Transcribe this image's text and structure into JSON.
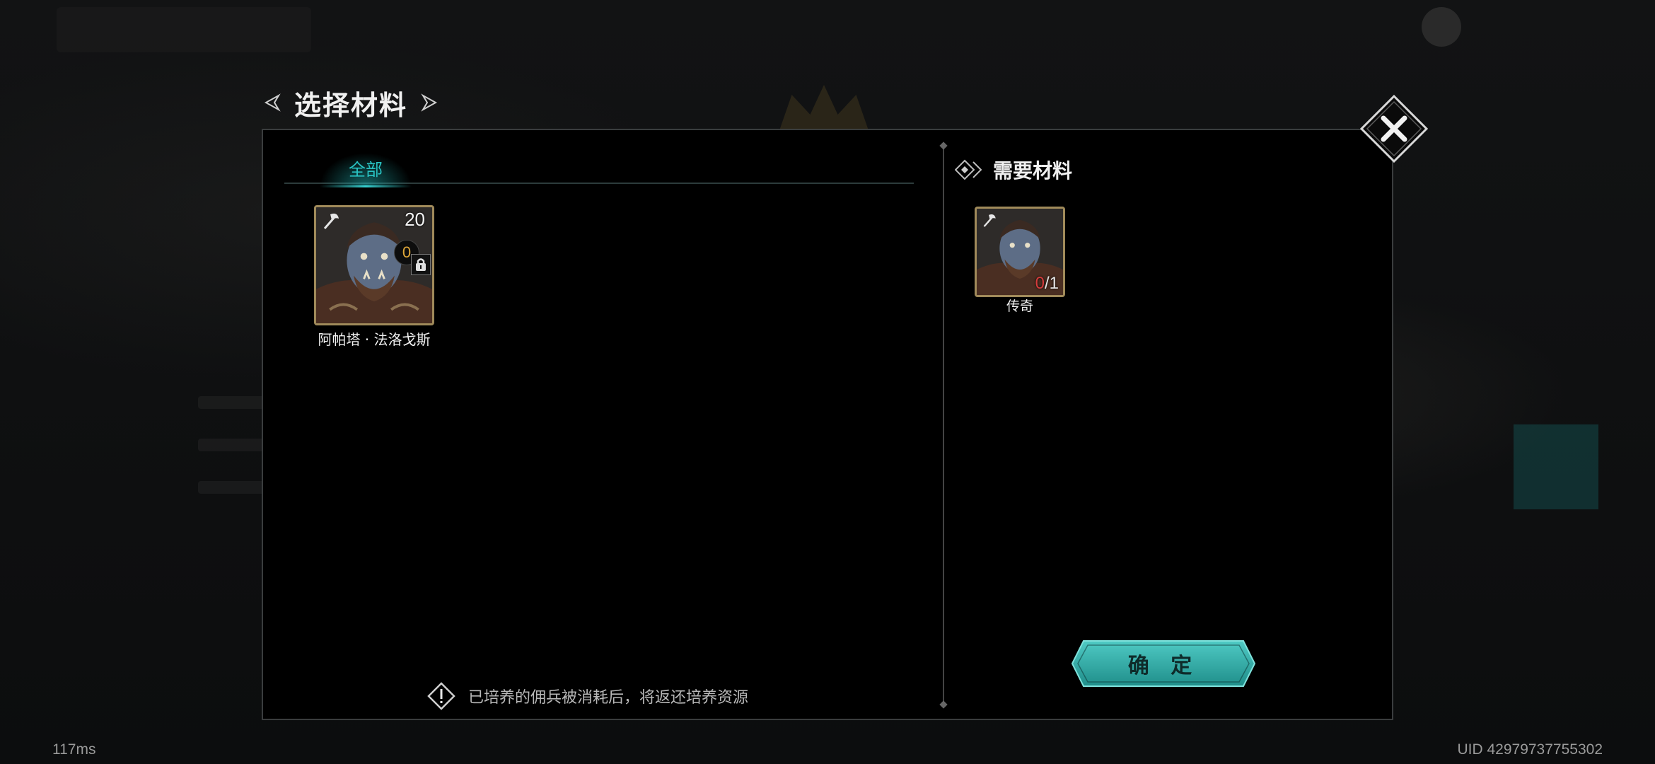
{
  "dialog": {
    "title": "选择材料",
    "tabs": [
      {
        "label": "全部",
        "active": true
      }
    ],
    "hero_card": {
      "name": "阿帕塔 · 法洛戈斯",
      "level": "20",
      "stars": "0",
      "class_icon": "axe-icon",
      "locked": true
    },
    "notice_text": "已培养的佣兵被消耗后，将返还培养资源",
    "required": {
      "header": "需要材料",
      "item": {
        "have": "0",
        "separator": "/",
        "need": "1",
        "rarity_label": "传奇",
        "class_icon": "axe-icon"
      }
    },
    "confirm_label": "确 定",
    "colors": {
      "accent": "#29c3c3",
      "button": "#2aa5a0",
      "frame": "#a08a5a",
      "shortage": "#d63c3c"
    }
  },
  "hud": {
    "latency": "117ms",
    "uid": "UID 42979737755302"
  }
}
